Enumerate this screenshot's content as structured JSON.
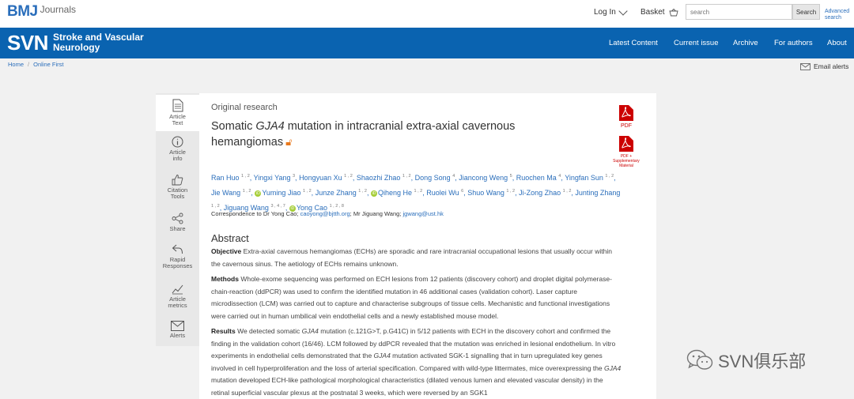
{
  "header": {
    "brand": "BMJ",
    "brand_sub": "Journals",
    "login_label": "Log In",
    "basket_label": "Basket",
    "search_placeholder": "search",
    "search_button": "Search",
    "advanced_search": "Advanced search"
  },
  "journal": {
    "mark": "SVN",
    "title_line1": "Stroke and Vascular",
    "title_line2": "Neurology",
    "nav": [
      "Latest Content",
      "Current issue",
      "Archive",
      "For authors",
      "About"
    ]
  },
  "breadcrumb": [
    "Home",
    "Online First"
  ],
  "email_alerts": "Email alerts",
  "rail": [
    {
      "label_1": "Article",
      "label_2": "Text",
      "icon": "document-icon"
    },
    {
      "label_1": "Article",
      "label_2": "info",
      "icon": "info-icon"
    },
    {
      "label_1": "Citation",
      "label_2": "Tools",
      "icon": "thumbs-up-icon"
    },
    {
      "label_1": "Share",
      "label_2": "",
      "icon": "share-icon"
    },
    {
      "label_1": "Rapid",
      "label_2": "Responses",
      "icon": "reply-icon"
    },
    {
      "label_1": "Article",
      "label_2": "metrics",
      "icon": "metrics-icon"
    },
    {
      "label_1": "Alerts",
      "label_2": "",
      "icon": "envelope-icon"
    }
  ],
  "article": {
    "type": "Original research",
    "title_pre": "Somatic ",
    "title_gene": "GJA4",
    "title_post": " mutation in intracranial extra-axial cavernous hemangiomas",
    "pdf_label": "PDF",
    "pdf_supp_label_1": "PDF +",
    "pdf_supp_label_2": "Supplementary",
    "pdf_supp_label_3": "Material",
    "authors": [
      {
        "name": "Ran Huo",
        "sup": "1 , 2",
        "orcid": false
      },
      {
        "name": "Yingxi Yang",
        "sup": "3",
        "orcid": false
      },
      {
        "name": "Hongyuan Xu",
        "sup": "1 , 2",
        "orcid": false
      },
      {
        "name": "Shaozhi Zhao",
        "sup": "1 , 2",
        "orcid": false
      },
      {
        "name": "Dong Song",
        "sup": "4",
        "orcid": false
      },
      {
        "name": "Jiancong Weng",
        "sup": "5",
        "orcid": false
      },
      {
        "name": "Ruochen Ma",
        "sup": "4",
        "orcid": false
      },
      {
        "name": "Yingfan Sun",
        "sup": "1 , 2",
        "orcid": false
      },
      {
        "name": "Jie Wang",
        "sup": "1 , 2",
        "orcid": false
      },
      {
        "name": "Yuming Jiao",
        "sup": "1 , 2",
        "orcid": true
      },
      {
        "name": "Junze Zhang",
        "sup": "1 , 2",
        "orcid": false
      },
      {
        "name": "Qiheng He",
        "sup": "1 , 2",
        "orcid": true
      },
      {
        "name": "Ruolei Wu",
        "sup": "6",
        "orcid": false
      },
      {
        "name": "Shuo Wang",
        "sup": "1 , 2",
        "orcid": false
      },
      {
        "name": "Ji-Zong Zhao",
        "sup": "1 , 2",
        "orcid": false
      },
      {
        "name": "Junting Zhang",
        "sup": "1 , 2",
        "orcid": false
      },
      {
        "name": "Jiguang Wang",
        "sup": "3 , 4 , 7",
        "orcid": false
      },
      {
        "name": "Yong Cao",
        "sup": "1 , 2 , 8",
        "orcid": true
      }
    ],
    "correspondence_pre": "Correspondence to Dr Yong Cao; ",
    "correspondence_email1": "caoyong@bjtth.org",
    "correspondence_mid": "; Mr Jiguang Wang; ",
    "correspondence_email2": "jgwang@ust.hk",
    "abstract_heading": "Abstract",
    "objective_label": "Objective",
    "objective_text": " Extra-axial cavernous hemangiomas (ECHs) are sporadic and rare intracranial occupational lesions that usually occur within the cavernous sinus. The aetiology of ECHs remains unknown.",
    "methods_label": "Methods",
    "methods_text": " Whole-exome sequencing was performed on ECH lesions from 12 patients (discovery cohort) and droplet digital polymerase-chain-reaction (ddPCR) was used to confirm the identified mutation in 46 additional cases (validation cohort). Laser capture microdissection (LCM) was carried out to capture and characterise subgroups of tissue cells. Mechanistic and functional investigations were carried out in human umbilical vein endothelial cells and a newly established mouse model.",
    "results_label": "Results",
    "results_t1": " We detected somatic ",
    "results_g1": "GJA4",
    "results_t2": " mutation (c.121G>T, p.G41C) in 5/12 patients with ECH in the discovery cohort and confirmed the finding in the validation cohort (16/46). LCM followed by ddPCR revealed that the mutation was enriched in lesional endothelium. In vitro experiments in endothelial cells demonstrated that the ",
    "results_g2": "GJA4",
    "results_t3": " mutation activated SGK-1 signalling that in turn upregulated key genes involved in cell hyperproliferation and the loss of arterial specification. Compared with wild-type littermates, mice overexpressing the ",
    "results_g3": "GJA4",
    "results_t4": " mutation developed ECH-like pathological morphological characteristics (dilated venous lumen and elevated vascular density) in the retinal superficial vascular plexus at the postnatal 3 weeks, which were reversed by an SGK1"
  },
  "watermark": "SVN俱乐部",
  "colors": {
    "brand_blue": "#0a63b0",
    "link_blue": "#2a6ebb",
    "pdf_red": "#cc0000",
    "open_access": "#e8791d",
    "orcid_green": "#a6ce39"
  }
}
